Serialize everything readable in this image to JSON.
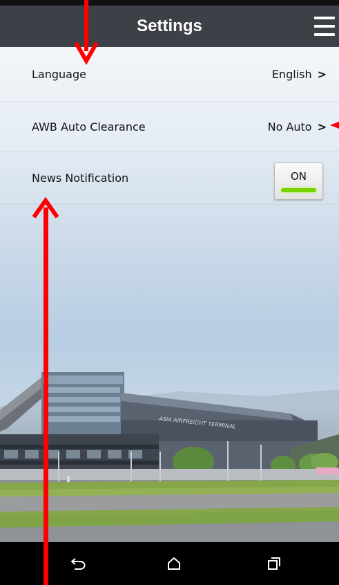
{
  "app_bar": {
    "title": "Settings"
  },
  "settings": {
    "language": {
      "label": "Language",
      "value": "English",
      "chevron": ">"
    },
    "awb": {
      "label": "AWB Auto Clearance",
      "value": "No Auto",
      "chevron": ">"
    },
    "news": {
      "label": "News Notification",
      "toggle_label": "ON",
      "toggle_state": true
    }
  },
  "background": {
    "building_sign": "ASIA AIRFREIGHT TERMINAL"
  },
  "colors": {
    "app_bar": "#3d4047",
    "toggle_on": "#7ad300",
    "annotation": "#ff0000"
  },
  "icons": {
    "menu": "hamburger-menu-icon",
    "back": "back-icon",
    "home": "home-icon",
    "recents": "recent-apps-icon"
  }
}
